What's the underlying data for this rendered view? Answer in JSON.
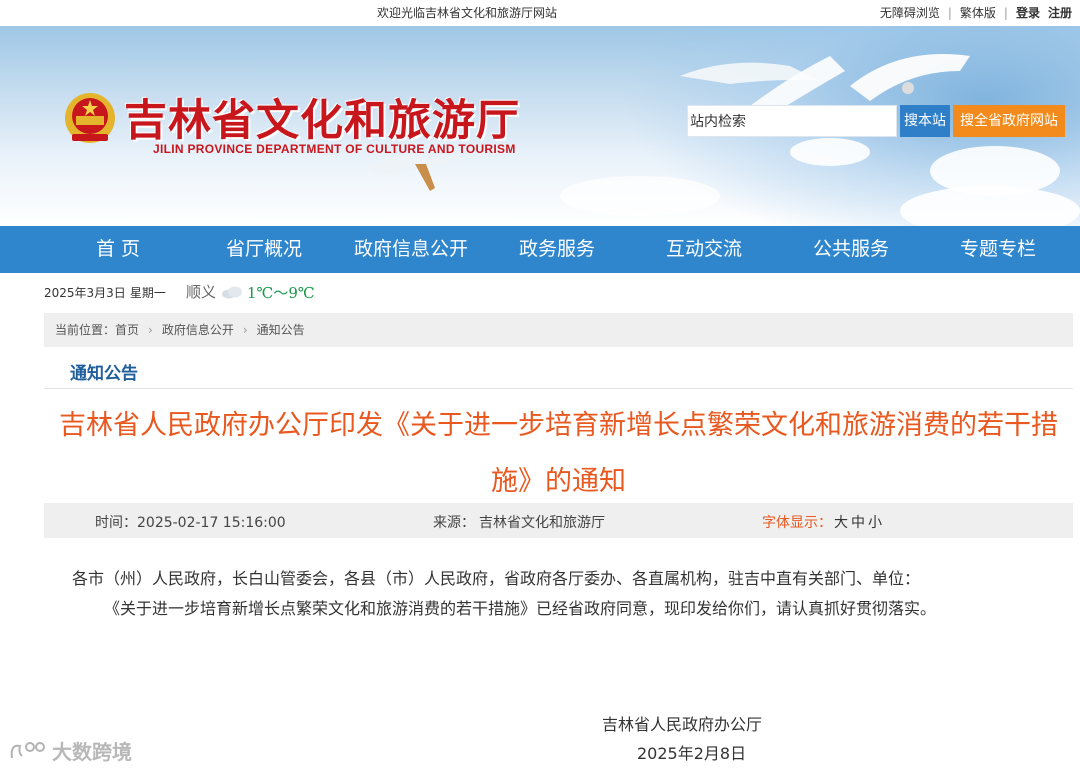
{
  "topbar": {
    "welcome": "欢迎光临吉林省文化和旅游厅网站",
    "accessibility": "无障碍浏览",
    "traditional": "繁体版",
    "login": "登录",
    "register": "注册"
  },
  "header": {
    "title": "吉林省文化和旅游厅",
    "subtitle": "JILIN PROVINCE DEPARTMENT OF CULTURE AND TOURISM",
    "search_value": "站内检索",
    "search_site_button": "搜本站",
    "search_all_button": "搜全省政府网站",
    "brand_red": "#c8161d",
    "nav_blue": "#2f86cd",
    "orange": "#f28b1c"
  },
  "nav": {
    "items": [
      "首 页",
      "省厅概况",
      "政府信息公开",
      "政务服务",
      "互动交流",
      "公共服务",
      "专题专栏"
    ]
  },
  "today": {
    "date": "2025年3月3日",
    "weekday": "星期一",
    "city": "顺义",
    "weather_icon": "cloudy-icon",
    "temp": "1℃～9℃"
  },
  "breadcrumb": {
    "prefix": "当前位置：",
    "items": [
      "首页",
      "政府信息公开",
      "通知公告"
    ]
  },
  "section": {
    "title": "通知公告"
  },
  "article": {
    "title": "吉林省人民政府办公厅印发《关于进一步培育新增长点繁荣文化和旅游消费的若干措施》的通知",
    "time_label": "时间：",
    "time": "2025-02-17 15:16:00",
    "source_label": "来源：",
    "source": "吉林省文化和旅游厅",
    "font_label": "字体显示：",
    "font_sizes": "大中小",
    "para1": "各市（州）人民政府，长白山管委会，各县（市）人民政府，省政府各厅委办、各直属机构，驻吉中直有关部门、单位：",
    "para2": "《关于进一步培育新增长点繁荣文化和旅游消费的若干措施》已经省政府同意，现印发给你们，请认真抓好贯彻落实。",
    "signature": "吉林省人民政府办公厅",
    "sign_date": "2025年2月8日"
  },
  "watermark": {
    "text": "大数跨境"
  }
}
